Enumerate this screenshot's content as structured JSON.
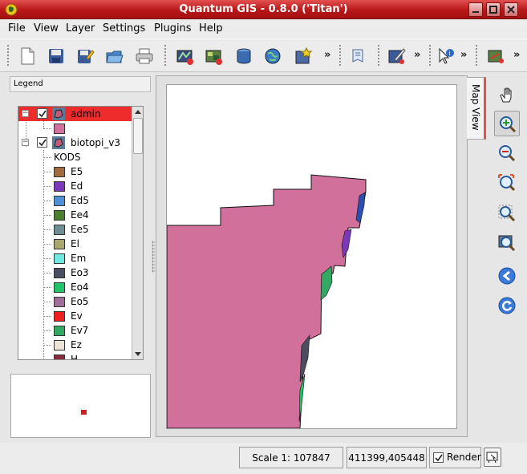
{
  "window": {
    "title": "Quantum GIS - 0.8.0 ('Titan')",
    "accent": "#c42020",
    "controls": [
      "minimize-icon",
      "maximize-icon",
      "close-icon"
    ]
  },
  "menu": {
    "file": "File",
    "view": "View",
    "layer": "Layer",
    "settings": "Settings",
    "plugins": "Plugins",
    "help": "Help"
  },
  "toolbar": {
    "groups": [
      [
        "new-project-icon",
        "save-project-icon",
        "save-as-icon",
        "open-project-icon",
        "print-icon"
      ],
      [
        "add-vector-layer-icon",
        "add-raster-layer-icon",
        "add-postgis-layer-icon",
        "add-wms-layer-icon",
        "new-layer-icon"
      ],
      [
        "map-tips-icon"
      ],
      [
        "capture-point-icon"
      ],
      [
        "identify-icon"
      ],
      [
        "measure-icon"
      ]
    ],
    "more": "»"
  },
  "legend": {
    "header": "Legend",
    "layers": [
      {
        "name": "admin",
        "selected": true,
        "checked": true,
        "classes": [
          {
            "label": "",
            "color": "#d2709c"
          }
        ]
      },
      {
        "name": "biotopi_v3",
        "selected": false,
        "checked": true,
        "field": "KODS",
        "classes": [
          {
            "label": "E5",
            "color": "#a06a3c"
          },
          {
            "label": "Ed",
            "color": "#7b38b8"
          },
          {
            "label": "Ed5",
            "color": "#4f8fd6"
          },
          {
            "label": "Ee4",
            "color": "#4b7e2f"
          },
          {
            "label": "Ee5",
            "color": "#6e8e94"
          },
          {
            "label": "El",
            "color": "#a8a870"
          },
          {
            "label": "Em",
            "color": "#6ee8e0"
          },
          {
            "label": "Eo3",
            "color": "#4a4e60"
          },
          {
            "label": "Eo4",
            "color": "#22c468"
          },
          {
            "label": "Eo5",
            "color": "#a0709a"
          },
          {
            "label": "Ev",
            "color": "#f02020"
          },
          {
            "label": "Ev7",
            "color": "#32a862"
          },
          {
            "label": "Ez",
            "color": "#ece4d6"
          },
          {
            "label": "H",
            "color": "#8a2a3c"
          }
        ]
      }
    ]
  },
  "map": {
    "tab_label": "Map View",
    "admin_fill": "#d2709c",
    "biotope_colors": [
      "#7b38b8",
      "#2a4fb0",
      "#32a862",
      "#4a4e60",
      "#22c468"
    ]
  },
  "map_tools": [
    "pan-icon",
    "zoom-in-icon",
    "zoom-out-icon",
    "zoom-full-icon",
    "zoom-to-selection-icon",
    "zoom-to-layer-icon",
    "zoom-last-icon",
    "refresh-icon"
  ],
  "status": {
    "scale": "Scale 1: 107847",
    "coordinates": "411399,405448",
    "render_label": "Render",
    "render_checked": true
  }
}
